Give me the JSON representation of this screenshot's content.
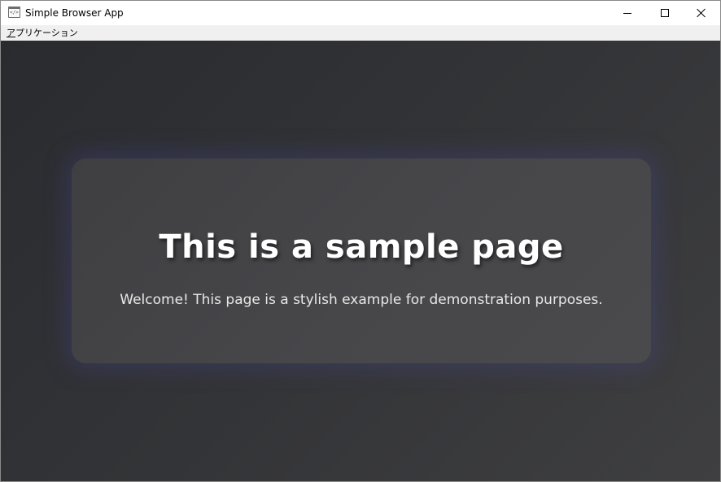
{
  "window": {
    "title": "Simple Browser App",
    "app_icon_glyph": "</>"
  },
  "menubar": {
    "items": [
      {
        "mnemonic": "ア",
        "rest": "プリケーション"
      }
    ]
  },
  "page": {
    "heading": "This is a sample page",
    "subtitle": "Welcome! This page is a stylish example for demonstration purposes."
  },
  "colors": {
    "content_background": "#333437",
    "card_background": "#47474a",
    "card_glow": "#4646a0",
    "heading_color": "#ffffff",
    "subtitle_color": "#e8e8e8"
  },
  "icons": {
    "app": "code-window-icon",
    "minimize": "minimize-icon",
    "maximize": "maximize-icon",
    "close": "close-icon"
  }
}
